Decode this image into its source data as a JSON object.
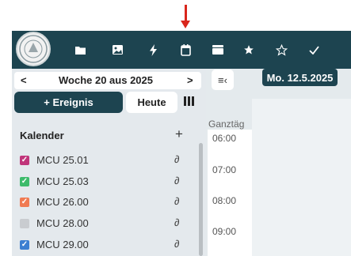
{
  "topbar": {
    "icons": [
      {
        "name": "folder-icon"
      },
      {
        "name": "image-icon"
      },
      {
        "name": "lightning-icon"
      },
      {
        "name": "calendar-icon"
      },
      {
        "name": "inbox-icon"
      },
      {
        "name": "star-icon"
      },
      {
        "name": "star-outline-icon"
      },
      {
        "name": "check-icon"
      }
    ],
    "color": "#1d4450"
  },
  "sidebar": {
    "week_title": "Woche 20 aus 2025",
    "prev": "<",
    "next": ">",
    "event_button": "+ Ereignis",
    "today_button": "Heute",
    "calendar_header": "Kalender",
    "add_symbol": "+",
    "calendars": [
      {
        "label": "MCU 25.01",
        "color": "#c0357a",
        "checked": true
      },
      {
        "label": "MCU 25.03",
        "color": "#3dbb6b",
        "checked": true
      },
      {
        "label": "MCU 26.00",
        "color": "#f07a52",
        "checked": true
      },
      {
        "label": "MCU 28.00",
        "color": "#c9ccd0",
        "checked": false
      },
      {
        "label": "MCU 29.00",
        "color": "#3c7fd1",
        "checked": true
      }
    ]
  },
  "main": {
    "collapse_symbol": "≡‹",
    "date_label": "Mo. 12.5.2025",
    "allday_label": "Ganztäg",
    "times": [
      "06:00",
      "07:00",
      "08:00",
      "09:00"
    ]
  }
}
